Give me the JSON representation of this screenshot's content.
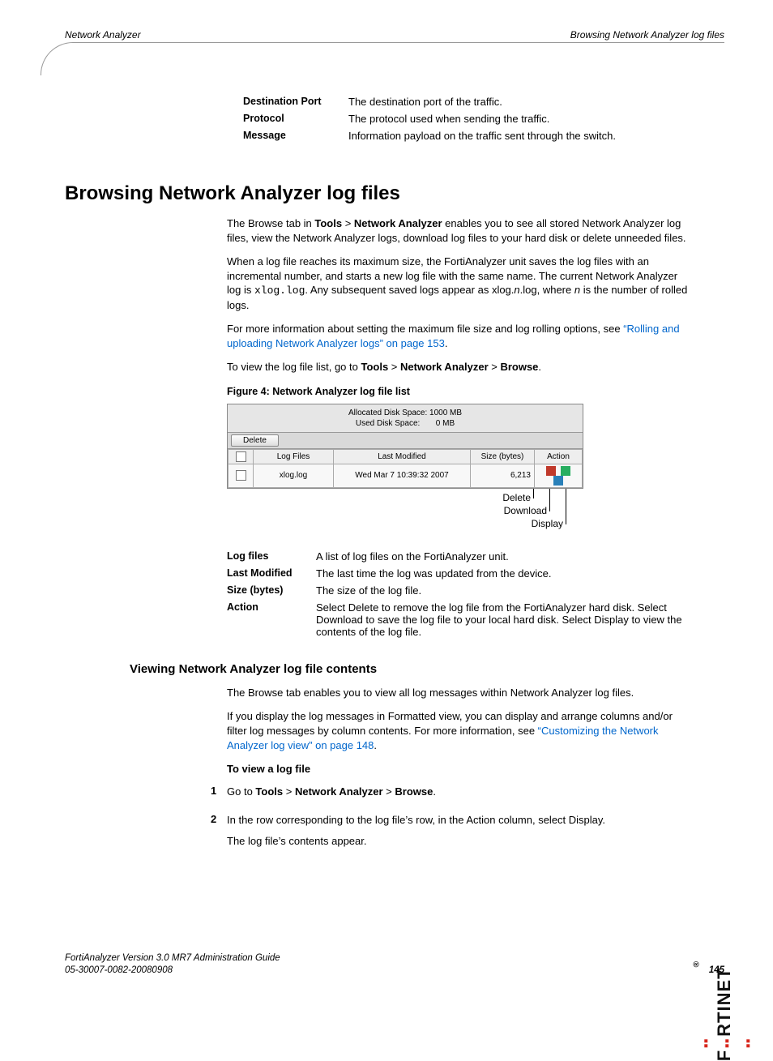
{
  "header": {
    "left": "Network Analyzer",
    "right": "Browsing Network Analyzer log files"
  },
  "top_defs": [
    {
      "term": "Destination Port",
      "desc": "The destination port of the traffic."
    },
    {
      "term": "Protocol",
      "desc": "The protocol used when sending the traffic."
    },
    {
      "term": "Message",
      "desc": "Information payload on the traffic sent through the switch."
    }
  ],
  "h1": "Browsing Network Analyzer log files",
  "intro": {
    "p1a": "The Browse tab in ",
    "p1b": "Tools",
    "p1c": " > ",
    "p1d": "Network Analyzer",
    "p1e": " enables you to see all stored Network Analyzer log files, view the Network Analyzer logs, download log files to your hard disk or delete unneeded files.",
    "p2a": "When a log file reaches its maximum size, the FortiAnalyzer unit saves the log files with an incremental number, and starts a new log file with the same name. The current Network Analyzer log is ",
    "p2code": "xlog.log",
    "p2b": ". Any subsequent saved logs appear as xlog.",
    "p2i": "n",
    "p2c": ".log, where ",
    "p2i2": "n",
    "p2d": " is the number of rolled logs.",
    "p3a": "For more information about setting the maximum file size and log rolling options, see ",
    "p3link": "“Rolling and uploading Network Analyzer logs” on page 153",
    "p3b": ".",
    "p4a": "To view the log file list, go to ",
    "p4b": "Tools",
    "p4c": " > ",
    "p4d": "Network Analyzer",
    "p4e": " > ",
    "p4f": "Browse",
    "p4g": "."
  },
  "figure": {
    "caption": "Figure 4:   Network Analyzer log file list",
    "alloc_label": "Allocated Disk Space:",
    "alloc_value": "1000 MB",
    "used_label": "Used Disk Space:",
    "used_value": "0 MB",
    "delete_btn": "Delete",
    "cols": {
      "c1": "Log Files",
      "c2": "Last Modified",
      "c3": "Size (bytes)",
      "c4": "Action"
    },
    "row": {
      "name": "xlog.log",
      "mod": "Wed Mar 7 10:39:32 2007",
      "size": "6,213"
    },
    "callouts": {
      "delete": "Delete",
      "download": "Download",
      "display": "Display"
    }
  },
  "col_defs": [
    {
      "term": "Log files",
      "desc": "A list of log files on the FortiAnalyzer unit."
    },
    {
      "term": "Last Modified",
      "desc": "The last time the log was updated from the device."
    },
    {
      "term": "Size (bytes)",
      "desc": "The size of the log file."
    },
    {
      "term": "Action",
      "desc": "Select Delete to remove the log file from the FortiAnalyzer hard disk. Select Download to save the log file to your local hard disk. Select Display to view the contents of the log file."
    }
  ],
  "h2": "Viewing Network Analyzer log file contents",
  "view": {
    "p1": "The Browse tab enables you to view all log messages within Network Analyzer log files.",
    "p2a": "If you display the log messages in Formatted view, you can display and arrange columns and/or filter log messages by column contents. For more information, see ",
    "p2link": "“Customizing the Network Analyzer log view” on page 148",
    "p2b": ".",
    "instr_head": "To view a log file",
    "step1a": "Go to ",
    "step1b": "Tools",
    "step1c": " > ",
    "step1d": "Network Analyzer",
    "step1e": " > ",
    "step1f": "Browse",
    "step1g": ".",
    "step2": "In the row corresponding to the log file’s row, in the Action column, select Display.",
    "step2b": "The log file’s contents appear."
  },
  "footer": {
    "line1": "FortiAnalyzer Version 3.0 MR7 Administration Guide",
    "line2": "05-30007-0082-20080908",
    "page": "145"
  },
  "brand": "F    RTINET"
}
